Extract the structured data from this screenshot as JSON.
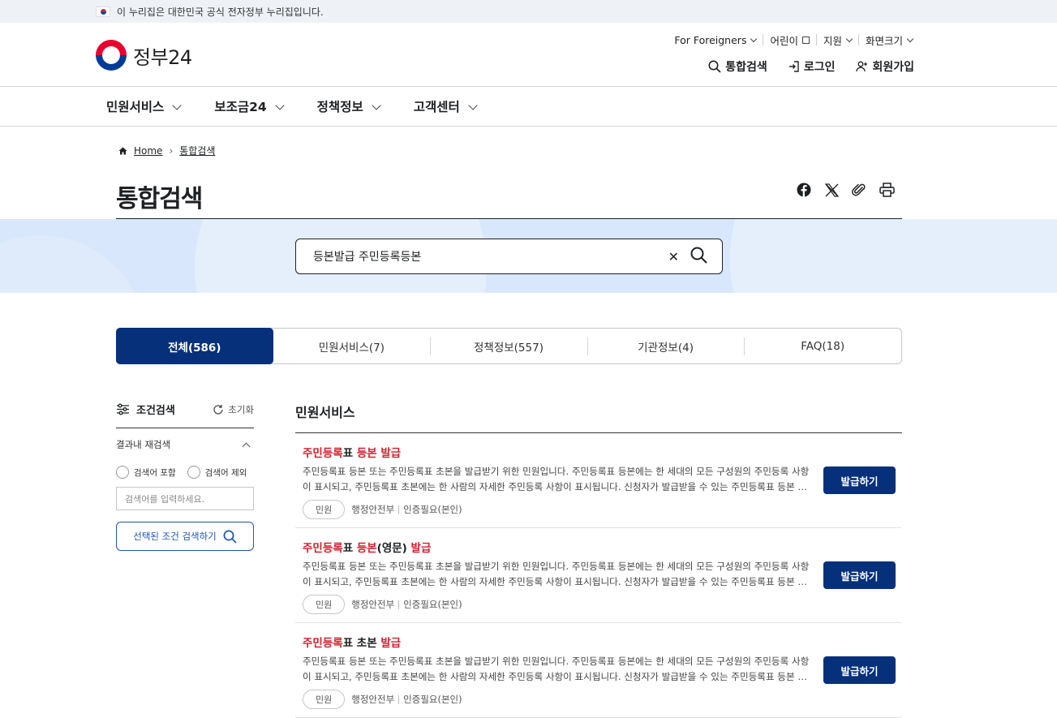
{
  "gov_banner": {
    "text": "이 누리집은 대한민국 공식 전자정부 누리집입니다."
  },
  "logo": {
    "text": "정부24"
  },
  "util": {
    "foreigners": "For Foreigners",
    "kids": "어린이",
    "support": "지원",
    "screen_size": "화면크기"
  },
  "actions": {
    "search": "통합검색",
    "login": "로그인",
    "signup": "회원가입"
  },
  "gnb": [
    "민원서비스",
    "보조금24",
    "정책정보",
    "고객센터"
  ],
  "breadcrumb": {
    "home": "Home",
    "current": "통합검색"
  },
  "page_title": "통합검색",
  "search": {
    "query": "등본발급 주민등록등본"
  },
  "tabs": [
    {
      "label": "전체(586)",
      "active": true
    },
    {
      "label": "민원서비스(7)",
      "active": false
    },
    {
      "label": "정책정보(557)",
      "active": false
    },
    {
      "label": "기관정보(4)",
      "active": false
    },
    {
      "label": "FAQ(18)",
      "active": false
    }
  ],
  "filter": {
    "title": "조건검색",
    "reset": "초기화",
    "section": "결과내 재검색",
    "include": "검색어 포함",
    "exclude": "검색어 제외",
    "placeholder": "검색어를 입력하세요.",
    "submit": "선택된 조건 검색하기"
  },
  "results": {
    "heading": "민원서비스",
    "items": [
      {
        "title_parts": [
          {
            "text": "주민등록",
            "hl": true
          },
          {
            "text": "표 ",
            "hl": false
          },
          {
            "text": "등본",
            "hl": true
          },
          {
            "text": " ",
            "hl": false
          },
          {
            "text": "발급",
            "hl": true
          }
        ],
        "desc": "주민등록표 등본 또는 주민등록표 초본을 발급받기 위한 민원입니다. 주민등록표 등본에는 한 세대의 모든 구성원의 주민등록 사항이 표시되고, 주민등록표 초본에는 한 사람의 자세한 주민등록 사항이 표시됩니다. 신청자가 발급받을 수 있는 주민등록표 등본 …",
        "badge": "민원",
        "agency": "행정안전부",
        "auth": "인증필요(본인)",
        "button": "발급하기"
      },
      {
        "title_parts": [
          {
            "text": "주민등록",
            "hl": true
          },
          {
            "text": "표 ",
            "hl": false
          },
          {
            "text": "등본",
            "hl": true
          },
          {
            "text": "(영문) ",
            "hl": false
          },
          {
            "text": "발급",
            "hl": true
          }
        ],
        "desc": "주민등록표 등본 또는 주민등록표 초본을 발급받기 위한 민원입니다. 주민등록표 등본에는 한 세대의 모든 구성원의 주민등록 사항이 표시되고, 주민등록표 초본에는 한 사람의 자세한 주민등록 사항이 표시됩니다. 신청자가 발급받을 수 있는 주민등록표 등본 …",
        "badge": "민원",
        "agency": "행정안전부",
        "auth": "인증필요(본인)",
        "button": "발급하기"
      },
      {
        "title_parts": [
          {
            "text": "주민등록",
            "hl": true
          },
          {
            "text": "표 초본 ",
            "hl": false
          },
          {
            "text": "발급",
            "hl": true
          }
        ],
        "desc": "주민등록표 등본 또는 주민등록표 초본을 발급받기 위한 민원입니다. 주민등록표 등본에는 한 세대의 모든 구성원의 주민등록 사항이 표시되고, 주민등록표 초본에는 한 사람의 자세한 주민등록 사항이 표시됩니다. 신청자가 발급받을 수 있는 주민등록표 등본 …",
        "badge": "민원",
        "agency": "행정안전부",
        "auth": "인증필요(본인)",
        "button": "발급하기"
      }
    ]
  }
}
